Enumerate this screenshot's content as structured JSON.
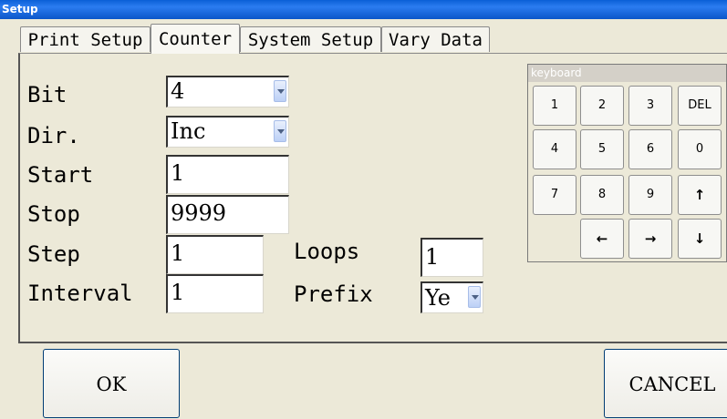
{
  "window": {
    "title": "Setup"
  },
  "tabs": [
    {
      "label": "Print Setup"
    },
    {
      "label": "Counter"
    },
    {
      "label": "System Setup"
    },
    {
      "label": "Vary Data"
    }
  ],
  "form": {
    "bit": {
      "label": "Bit",
      "value": "4"
    },
    "dir": {
      "label": "Dir.",
      "value": "Inc"
    },
    "start": {
      "label": "Start",
      "value": "1"
    },
    "stop": {
      "label": "Stop",
      "value": "9999"
    },
    "step": {
      "label": "Step",
      "value": "1"
    },
    "interval": {
      "label": "Interval",
      "value": "1"
    },
    "loops": {
      "label": "Loops",
      "value": "1"
    },
    "prefix": {
      "label": "Prefix",
      "value": "Ye"
    }
  },
  "keyboard": {
    "title": "keyboard",
    "keys": [
      "1",
      "2",
      "3",
      "DEL",
      "4",
      "5",
      "6",
      "0",
      "7",
      "8",
      "9",
      "↑",
      "←",
      "→",
      "↓"
    ]
  },
  "buttons": {
    "ok": "OK",
    "cancel": "CANCEL"
  }
}
